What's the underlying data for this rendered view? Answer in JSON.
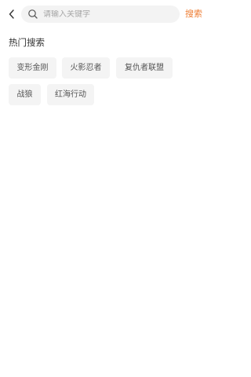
{
  "search": {
    "placeholder": "请输入关键字",
    "button_label": "搜索"
  },
  "hot": {
    "title": "热门搜索",
    "tags": [
      "变形金刚",
      "火影忍者",
      "复仇者联盟",
      "战狼",
      "红海行动"
    ]
  },
  "colors": {
    "accent": "#ee7d33",
    "tag_bg": "#f4f4f4",
    "search_bg": "#f3f3f3"
  },
  "icons": {
    "back": "chevron-left-icon",
    "search": "search-icon"
  }
}
